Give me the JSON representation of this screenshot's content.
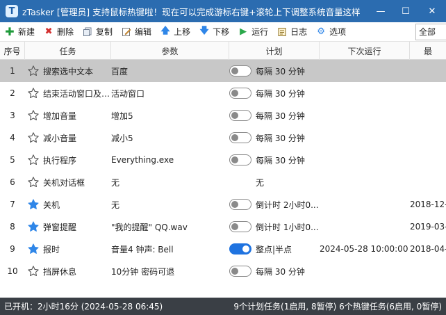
{
  "window": {
    "title": "zTasker [管理员]  支持鼠标热键啦！现在可以完成游标右键+滚轮上下调整系统音量这样",
    "app_icon_letter": "T",
    "minimize": "—",
    "maximize": "☐",
    "close": "✕"
  },
  "toolbar": {
    "new": "新建",
    "delete": "删除",
    "copy": "复制",
    "edit": "编辑",
    "move_up": "上移",
    "move_down": "下移",
    "run": "运行",
    "log": "日志",
    "options": "选项",
    "filter_value": "全部"
  },
  "columns": {
    "idx": "序号",
    "task": "任务",
    "param": "参数",
    "plan": "计划",
    "next_run": "下次运行",
    "last": "最"
  },
  "rows": [
    {
      "idx": "1",
      "task": "搜索选中文本",
      "param": "百度",
      "plan": "每隔 30 分钟",
      "next": "",
      "last": "",
      "starred": false,
      "toggle": "off",
      "selected": true
    },
    {
      "idx": "2",
      "task": "结束活动窗口及进程",
      "param": "活动窗口",
      "plan": "每隔 30 分钟",
      "next": "",
      "last": "",
      "starred": false,
      "toggle": "off",
      "selected": false
    },
    {
      "idx": "3",
      "task": "增加音量",
      "param": "增加5",
      "plan": "每隔 30 分钟",
      "next": "",
      "last": "",
      "starred": false,
      "toggle": "off",
      "selected": false
    },
    {
      "idx": "4",
      "task": "减小音量",
      "param": "减小5",
      "plan": "每隔 30 分钟",
      "next": "",
      "last": "",
      "starred": false,
      "toggle": "off",
      "selected": false
    },
    {
      "idx": "5",
      "task": "执行程序",
      "param": "Everything.exe",
      "plan": "每隔 30 分钟",
      "next": "",
      "last": "",
      "starred": false,
      "toggle": "off",
      "selected": false
    },
    {
      "idx": "6",
      "task": "关机对话框",
      "param": "无",
      "plan": "无",
      "next": "",
      "last": "",
      "starred": false,
      "toggle": "none",
      "selected": false
    },
    {
      "idx": "7",
      "task": "关机",
      "param": "无",
      "plan": "倒计时 2小时0...",
      "next": "",
      "last": "2018-12-",
      "starred": true,
      "toggle": "off",
      "selected": false
    },
    {
      "idx": "8",
      "task": "弹窗提醒",
      "param": "\"我的提醒\" QQ.wav",
      "plan": "倒计时 1小时0...",
      "next": "",
      "last": "2019-03-",
      "starred": true,
      "toggle": "off",
      "selected": false
    },
    {
      "idx": "9",
      "task": "报时",
      "param": "音量4 钟声: Bell",
      "plan": "整点|半点",
      "next": "2024-05-28 10:00:00",
      "last": "2018-04-",
      "starred": true,
      "toggle": "on",
      "selected": false
    },
    {
      "idx": "10",
      "task": "挡屏休息",
      "param": "10分钟 密码可退",
      "plan": "每隔 30 分钟",
      "next": "",
      "last": "",
      "starred": false,
      "toggle": "off",
      "selected": false
    }
  ],
  "status": {
    "uptime": "已开机：2小时16分 (2024-05-28 06:45)",
    "summary": "9个计划任务(1启用, 8暂停)  6个热键任务(6启用, 0暂停)"
  },
  "colors": {
    "titlebar": "#2b6cb0",
    "star_active": "#2f86e8",
    "toggle_on": "#1f73e0",
    "selected_row": "#c8c8c8",
    "statusbar": "#3a3f45"
  },
  "icons": {
    "new": "plus-icon",
    "delete": "x-icon",
    "copy": "copy-icon",
    "edit": "edit-icon",
    "move_up": "arrow-up-icon",
    "move_down": "arrow-down-icon",
    "run": "play-icon",
    "log": "log-icon",
    "options": "gear-icon",
    "star": "star-icon"
  }
}
